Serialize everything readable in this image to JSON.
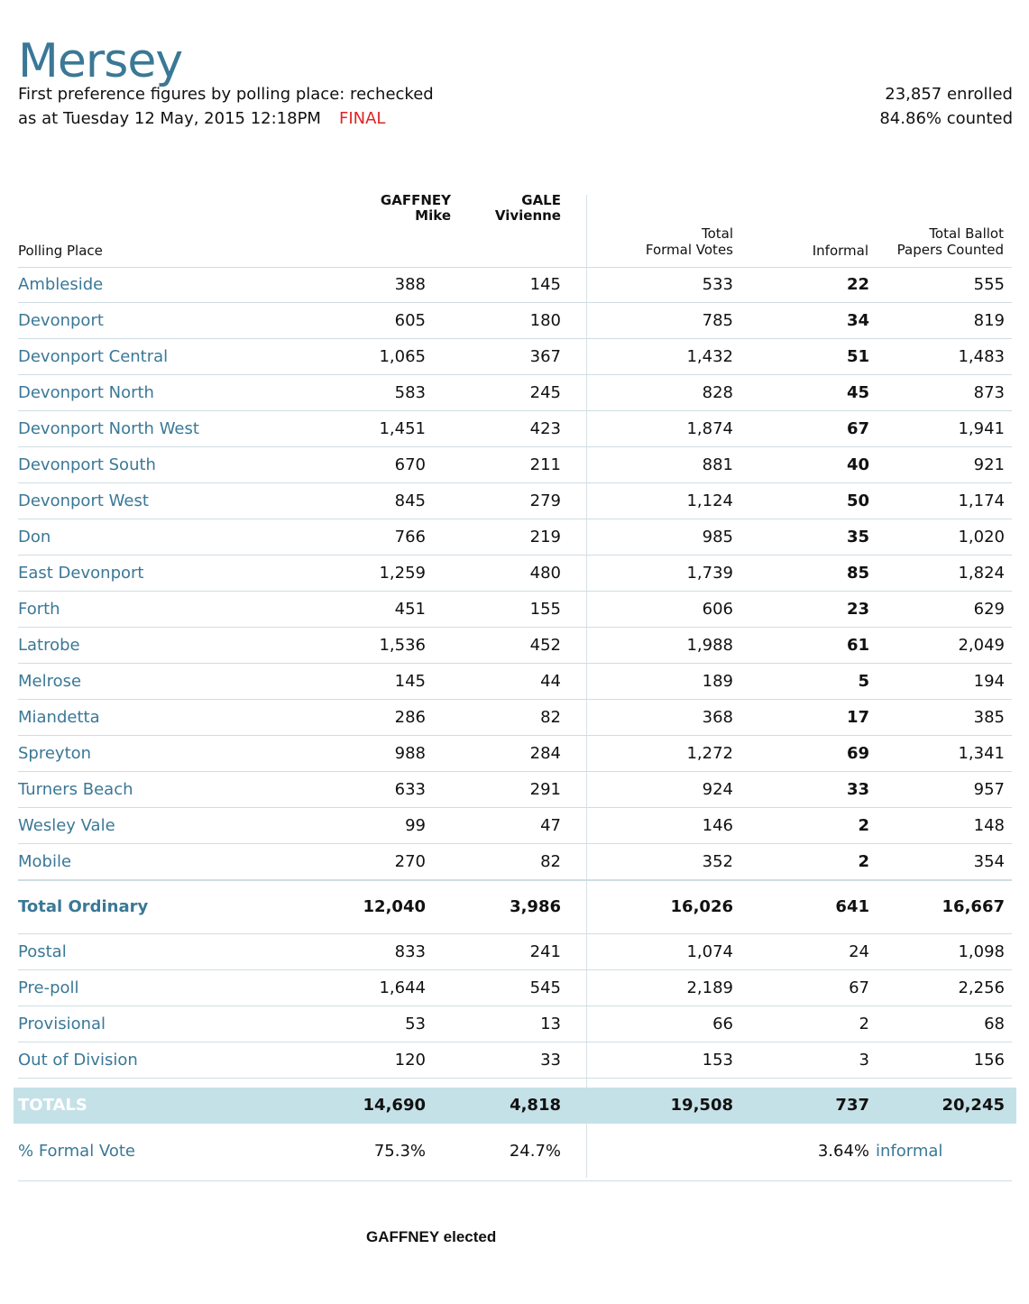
{
  "header": {
    "title": "Mersey",
    "subtitle": "First preference figures by polling place: rechecked",
    "as_at": "as at Tuesday 12 May, 2015 12:18PM",
    "status": "FINAL",
    "enrolled": "23,857 enrolled",
    "counted": "84.86% counted"
  },
  "columns": {
    "polling_place": "Polling Place",
    "cand1_surname": "GAFFNEY",
    "cand1_first": "Mike",
    "cand2_surname": "GALE",
    "cand2_first": "Vivienne",
    "total_line1": "Total",
    "total_line2": "Formal Votes",
    "informal": "Informal",
    "ballot_line1": "Total Ballot",
    "ballot_line2": "Papers Counted"
  },
  "rows": [
    {
      "place": "Ambleside",
      "gaffney": "388",
      "gale": "145",
      "formal": "533",
      "informal": "22",
      "total": "555"
    },
    {
      "place": "Devonport",
      "gaffney": "605",
      "gale": "180",
      "formal": "785",
      "informal": "34",
      "total": "819"
    },
    {
      "place": "Devonport Central",
      "gaffney": "1,065",
      "gale": "367",
      "formal": "1,432",
      "informal": "51",
      "total": "1,483"
    },
    {
      "place": "Devonport North",
      "gaffney": "583",
      "gale": "245",
      "formal": "828",
      "informal": "45",
      "total": "873"
    },
    {
      "place": "Devonport North West",
      "gaffney": "1,451",
      "gale": "423",
      "formal": "1,874",
      "informal": "67",
      "total": "1,941"
    },
    {
      "place": "Devonport South",
      "gaffney": "670",
      "gale": "211",
      "formal": "881",
      "informal": "40",
      "total": "921"
    },
    {
      "place": "Devonport West",
      "gaffney": "845",
      "gale": "279",
      "formal": "1,124",
      "informal": "50",
      "total": "1,174"
    },
    {
      "place": "Don",
      "gaffney": "766",
      "gale": "219",
      "formal": "985",
      "informal": "35",
      "total": "1,020"
    },
    {
      "place": "East Devonport",
      "gaffney": "1,259",
      "gale": "480",
      "formal": "1,739",
      "informal": "85",
      "total": "1,824"
    },
    {
      "place": "Forth",
      "gaffney": "451",
      "gale": "155",
      "formal": "606",
      "informal": "23",
      "total": "629"
    },
    {
      "place": "Latrobe",
      "gaffney": "1,536",
      "gale": "452",
      "formal": "1,988",
      "informal": "61",
      "total": "2,049"
    },
    {
      "place": "Melrose",
      "gaffney": "145",
      "gale": "44",
      "formal": "189",
      "informal": "5",
      "total": "194"
    },
    {
      "place": "Miandetta",
      "gaffney": "286",
      "gale": "82",
      "formal": "368",
      "informal": "17",
      "total": "385"
    },
    {
      "place": "Spreyton",
      "gaffney": "988",
      "gale": "284",
      "formal": "1,272",
      "informal": "69",
      "total": "1,341"
    },
    {
      "place": "Turners Beach",
      "gaffney": "633",
      "gale": "291",
      "formal": "924",
      "informal": "33",
      "total": "957"
    },
    {
      "place": "Wesley Vale",
      "gaffney": "99",
      "gale": "47",
      "formal": "146",
      "informal": "2",
      "total": "148"
    },
    {
      "place": "Mobile",
      "gaffney": "270",
      "gale": "82",
      "formal": "352",
      "informal": "2",
      "total": "354"
    }
  ],
  "total_ordinary": {
    "place": "Total Ordinary",
    "gaffney": "12,040",
    "gale": "3,986",
    "formal": "16,026",
    "informal": "641",
    "total": "16,667"
  },
  "other_rows": [
    {
      "place": "Postal",
      "gaffney": "833",
      "gale": "241",
      "formal": "1,074",
      "informal": "24",
      "total": "1,098"
    },
    {
      "place": "Pre-poll",
      "gaffney": "1,644",
      "gale": "545",
      "formal": "2,189",
      "informal": "67",
      "total": "2,256"
    },
    {
      "place": "Provisional",
      "gaffney": "53",
      "gale": "13",
      "formal": "66",
      "informal": "2",
      "total": "68"
    },
    {
      "place": "Out of Division",
      "gaffney": "120",
      "gale": "33",
      "formal": "153",
      "informal": "3",
      "total": "156"
    }
  ],
  "totals": {
    "label": "TOTALS",
    "gaffney": "14,690",
    "gale": "4,818",
    "formal": "19,508",
    "informal": "737",
    "total": "20,245"
  },
  "formal_vote": {
    "label": "% Formal Vote",
    "gaffney": "75.3%",
    "gale": "24.7%",
    "informal_pct": "3.64%",
    "informal_label": "informal"
  },
  "result": "GAFFNEY elected",
  "colors": {
    "accent": "#3a7896",
    "final": "#e02424",
    "totals_bg": "#c5e1e8",
    "rule": "#cfdde3"
  }
}
